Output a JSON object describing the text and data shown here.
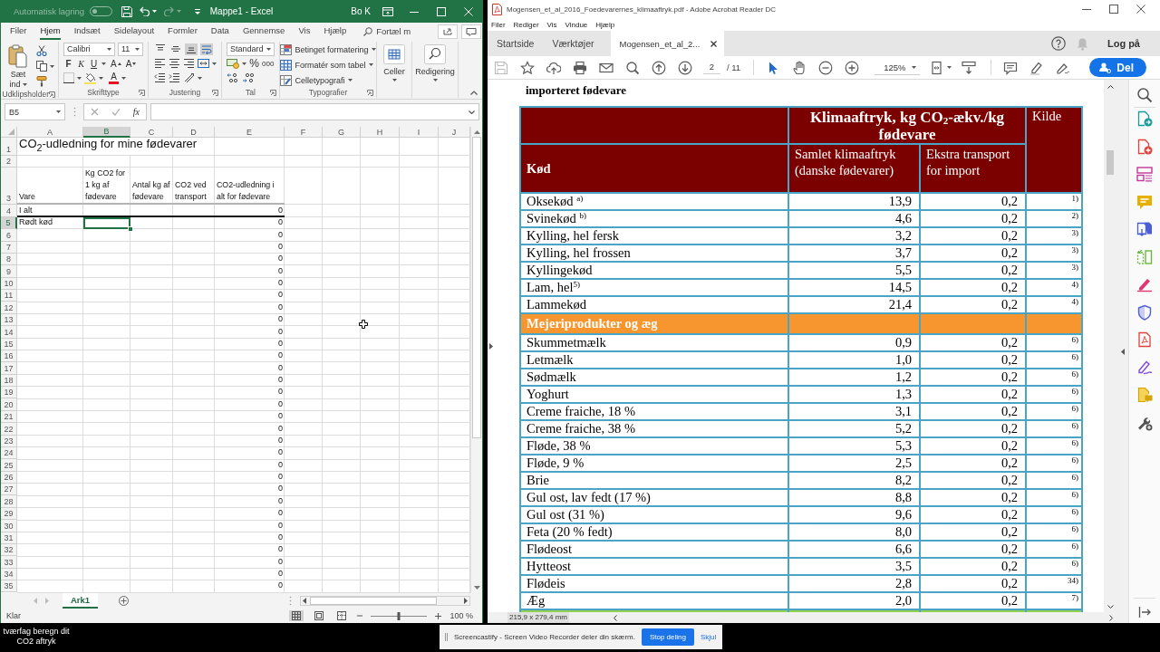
{
  "excel": {
    "title_bar": {
      "autosave_label": "Automatisk lagring",
      "autosave_on": false,
      "redo_disabled": true,
      "title": "Mappe1 - Excel",
      "user": "Bo K"
    },
    "ribbon_tabs": [
      {
        "label": "Filer",
        "selected": false
      },
      {
        "label": "Hjem",
        "selected": true
      },
      {
        "label": "Indsæt",
        "selected": false
      },
      {
        "label": "Sidelayout",
        "selected": false
      },
      {
        "label": "Formler",
        "selected": false
      },
      {
        "label": "Data",
        "selected": false
      },
      {
        "label": "Gennemse",
        "selected": false
      },
      {
        "label": "Vis",
        "selected": false
      },
      {
        "label": "Hjælp",
        "selected": false
      }
    ],
    "tell_me": "Fortæl m",
    "groups": {
      "clipboard": {
        "label": "Udklipsholder",
        "paste": "Sæt ind"
      },
      "font": {
        "label": "Skrifttype",
        "font_name": "Calibri",
        "font_size": "11",
        "bold": "F",
        "italic": "K",
        "underline": "U",
        "grow_font": "A",
        "shrink_font": "A",
        "font_color": "A"
      },
      "alignment": {
        "label": "Justering",
        "vertical_align": [
          {
            "kind": "top",
            "selected": false
          },
          {
            "kind": "middle",
            "selected": false
          },
          {
            "kind": "bottom",
            "selected": true
          }
        ],
        "wrap_text_on": true
      },
      "number": {
        "label": "Tal",
        "format": "Standard",
        "percent": "%",
        "thousands": "000"
      },
      "styles": {
        "label": "Typografier",
        "items": [
          {
            "kind": "conditional",
            "label": "Betinget formatering"
          },
          {
            "kind": "table",
            "label": "Formatér som tabel"
          },
          {
            "kind": "cell_styles",
            "label": "Celletypografi"
          }
        ]
      },
      "cells": {
        "label": "Celler"
      },
      "editing": {
        "label": "Redigering"
      }
    },
    "formula_bar": {
      "name_box": "B5",
      "function_label": "fx"
    },
    "sheet": {
      "columns": [
        {
          "label": "A",
          "selected": false
        },
        {
          "label": "B",
          "selected": true
        },
        {
          "label": "C",
          "selected": false
        },
        {
          "label": "D",
          "selected": false
        },
        {
          "label": "E",
          "selected": false
        },
        {
          "label": "F",
          "selected": false
        },
        {
          "label": "G",
          "selected": false
        },
        {
          "label": "H",
          "selected": false
        },
        {
          "label": "I",
          "selected": false
        },
        {
          "label": "J",
          "selected": false
        }
      ],
      "rows": [
        {
          "number": "1",
          "kind": "title",
          "selected": false,
          "cells": {
            "a": "CO$_{2}$-udledning for mine fødevarer"
          }
        },
        {
          "number": "2",
          "kind": "data",
          "selected": false
        },
        {
          "number": "3",
          "kind": "header",
          "selected": false,
          "cells": {
            "a": "Vare",
            "b": "Kg CO2 for 1 kg af fødevare",
            "c": "Antal kg af fødevare",
            "d": "CO2 ved transport",
            "e": "CO2-udledning i alt for fødevare"
          }
        },
        {
          "number": "4",
          "kind": "total",
          "selected": false,
          "cells": {
            "a": "I alt",
            "e": "0"
          }
        },
        {
          "number": "5",
          "kind": "data",
          "selected": true,
          "cells": {
            "a": "Rødt kød",
            "e": "0"
          }
        },
        {
          "number": "6",
          "kind": "data",
          "selected": false,
          "cells": {
            "e": "0"
          }
        },
        {
          "number": "7",
          "kind": "data",
          "selected": false,
          "cells": {
            "e": "0"
          }
        },
        {
          "number": "8",
          "kind": "data",
          "selected": false,
          "cells": {
            "e": "0"
          }
        },
        {
          "number": "9",
          "kind": "data",
          "selected": false,
          "cells": {
            "e": "0"
          }
        },
        {
          "number": "10",
          "kind": "data",
          "selected": false,
          "cells": {
            "e": "0"
          }
        },
        {
          "number": "11",
          "kind": "data",
          "selected": false,
          "cells": {
            "e": "0"
          }
        },
        {
          "number": "12",
          "kind": "data",
          "selected": false,
          "cells": {
            "e": "0"
          }
        },
        {
          "number": "13",
          "kind": "data",
          "selected": false,
          "cells": {
            "e": "0"
          }
        },
        {
          "number": "14",
          "kind": "data",
          "selected": false,
          "cells": {
            "e": "0"
          }
        },
        {
          "number": "15",
          "kind": "data",
          "selected": false,
          "cells": {
            "e": "0"
          }
        },
        {
          "number": "16",
          "kind": "data",
          "selected": false,
          "cells": {
            "e": "0"
          }
        },
        {
          "number": "17",
          "kind": "data",
          "selected": false,
          "cells": {
            "e": "0"
          }
        },
        {
          "number": "18",
          "kind": "data",
          "selected": false,
          "cells": {
            "e": "0"
          }
        },
        {
          "number": "19",
          "kind": "data",
          "selected": false,
          "cells": {
            "e": "0"
          }
        },
        {
          "number": "20",
          "kind": "data",
          "selected": false,
          "cells": {
            "e": "0"
          }
        },
        {
          "number": "21",
          "kind": "data",
          "selected": false,
          "cells": {
            "e": "0"
          }
        },
        {
          "number": "22",
          "kind": "data",
          "selected": false,
          "cells": {
            "e": "0"
          }
        },
        {
          "number": "23",
          "kind": "data",
          "selected": false,
          "cells": {
            "e": "0"
          }
        },
        {
          "number": "24",
          "kind": "data",
          "selected": false,
          "cells": {
            "e": "0"
          }
        },
        {
          "number": "25",
          "kind": "data",
          "selected": false,
          "cells": {
            "e": "0"
          }
        },
        {
          "number": "26",
          "kind": "data",
          "selected": false,
          "cells": {
            "e": "0"
          }
        },
        {
          "number": "27",
          "kind": "data",
          "selected": false,
          "cells": {
            "e": "0"
          }
        },
        {
          "number": "28",
          "kind": "data",
          "selected": false,
          "cells": {
            "e": "0"
          }
        },
        {
          "number": "29",
          "kind": "data",
          "selected": false,
          "cells": {
            "e": "0"
          }
        },
        {
          "number": "30",
          "kind": "data",
          "selected": false,
          "cells": {
            "e": "0"
          }
        },
        {
          "number": "31",
          "kind": "data",
          "selected": false,
          "cells": {
            "e": "0"
          }
        },
        {
          "number": "32",
          "kind": "data",
          "selected": false,
          "cells": {
            "e": "0"
          }
        },
        {
          "number": "33",
          "kind": "data",
          "selected": false,
          "cells": {
            "e": "0"
          }
        },
        {
          "number": "34",
          "kind": "data",
          "selected": false,
          "cells": {
            "e": "0"
          }
        },
        {
          "number": "35",
          "kind": "data",
          "selected": false,
          "cells": {
            "e": "0"
          }
        }
      ]
    },
    "sheet_tabs": [
      {
        "label": "Ark1",
        "selected": true
      }
    ],
    "status_bar": {
      "status": "Klar",
      "view_modes": [
        {
          "kind": "normal",
          "selected": true
        },
        {
          "kind": "page_layout",
          "selected": false
        },
        {
          "kind": "page_break",
          "selected": false
        }
      ],
      "zoom": {
        "level": 0.5,
        "reading": "100 %"
      }
    }
  },
  "acrobat": {
    "title": "Mogensen_et_al_2016_Foedevarernes_klimaaftryk.pdf - Adobe Acrobat Reader DC",
    "menu": [
      "Filer",
      "Rediger",
      "Vis",
      "Vindue",
      "Hjælp"
    ],
    "tabs": [
      {
        "label": "Startside",
        "selected": false,
        "closable": false
      },
      {
        "label": "Værktøjer",
        "selected": false,
        "closable": false
      },
      {
        "label": "Mogensen_et_al_2...",
        "selected": true,
        "closable": true
      }
    ],
    "sign_in": "Log på",
    "toolbar": {
      "save_disabled": true,
      "page": "2",
      "page_count": "/ 11",
      "tools": [
        {
          "kind": "select",
          "selected": true
        },
        {
          "kind": "hand",
          "selected": false
        }
      ],
      "zoom": "125%",
      "share": "Del"
    },
    "document": {
      "heading": "importeret fødevare",
      "table": {
        "header": {
          "title": "Klimaaftryk,  kg CO$_{2}$-ækv./kg fødevare",
          "source": "Kilde",
          "category": "Kød",
          "total": "Samlet klimaaftryk (danske fødevarer)",
          "transport": "Ekstra transport for import"
        },
        "rows": [
          {
            "kind": "item",
            "name": "Oksekød $^{a)}$",
            "total": "13,9",
            "transport": "0,2",
            "source": "1)"
          },
          {
            "kind": "item",
            "name": "Svinekød $^{b)}$",
            "total": "4,6",
            "transport": "0,2",
            "source": "2)"
          },
          {
            "kind": "item",
            "name": "Kylling, hel fersk",
            "total": "3,2",
            "transport": "0,2",
            "source": "3)"
          },
          {
            "kind": "item",
            "name": "Kylling, hel frossen",
            "total": "3,7",
            "transport": "0,2",
            "source": "3)"
          },
          {
            "kind": "item",
            "name": "Kyllingekød",
            "total": "5,5",
            "transport": "0,2",
            "source": "3)"
          },
          {
            "kind": "item",
            "name": "Lam, hel$^{5)}$",
            "total": "14,5",
            "transport": "0,2",
            "source": "4)"
          },
          {
            "kind": "item",
            "name": "Lammekød",
            "total": "21,4",
            "transport": "0,2",
            "source": "4)"
          },
          {
            "kind": "section",
            "name": "Mejeriprodukter og æg",
            "color": "#f7962f"
          },
          {
            "kind": "item",
            "name": "Skummetmælk",
            "total": "0,9",
            "transport": "0,2",
            "source": "6)"
          },
          {
            "kind": "item",
            "name": "Letmælk",
            "total": "1,0",
            "transport": "0,2",
            "source": "6)"
          },
          {
            "kind": "item",
            "name": "Sødmælk",
            "total": "1,2",
            "transport": "0,2",
            "source": "6)"
          },
          {
            "kind": "item",
            "name": "Yoghurt",
            "total": "1,3",
            "transport": "0,2",
            "source": "6)"
          },
          {
            "kind": "item",
            "name": "Creme fraiche, 18 %",
            "total": "3,1",
            "transport": "0,2",
            "source": "6)"
          },
          {
            "kind": "item",
            "name": "Creme fraiche, 38 %",
            "total": "5,2",
            "transport": "0,2",
            "source": "6)"
          },
          {
            "kind": "item",
            "name": "Fløde, 38 %",
            "total": "5,3",
            "transport": "0,2",
            "source": "6)"
          },
          {
            "kind": "item",
            "name": "Fløde, 9 %",
            "total": "2,5",
            "transport": "0,2",
            "source": "6)"
          },
          {
            "kind": "item",
            "name": "Brie",
            "total": "8,2",
            "transport": "0,2",
            "source": "6)"
          },
          {
            "kind": "item",
            "name": "Gul ost, lav fedt (17 %)",
            "total": "8,8",
            "transport": "0,2",
            "source": "6)"
          },
          {
            "kind": "item",
            "name": "Gul ost (31 %)",
            "total": "9,6",
            "transport": "0,2",
            "source": "6)"
          },
          {
            "kind": "item",
            "name": "Feta (20 % fedt)",
            "total": "8,0",
            "transport": "0,2",
            "source": "6)"
          },
          {
            "kind": "item",
            "name": "Flødeost",
            "total": "6,6",
            "transport": "0,2",
            "source": "6)"
          },
          {
            "kind": "item",
            "name": "Hytteost",
            "total": "3,5",
            "transport": "0,2",
            "source": "6)"
          },
          {
            "kind": "item",
            "name": "Flødeis",
            "total": "2,8",
            "transport": "0,2",
            "source": "34)"
          },
          {
            "kind": "item",
            "name": "Æg",
            "total": "2,0",
            "transport": "0,2",
            "source": "7)"
          },
          {
            "kind": "section",
            "color": "#92d050"
          }
        ]
      }
    },
    "page_size": "215,9 x 279,4 mm"
  },
  "desktop": {
    "icon_label": "tværfag beregn dit CO2 aftryk"
  },
  "share_notice": {
    "message": "Screencastify - Screen Video Recorder deler din skærm.",
    "stop_button": "Stop deling",
    "hide_link": "Skjul"
  }
}
